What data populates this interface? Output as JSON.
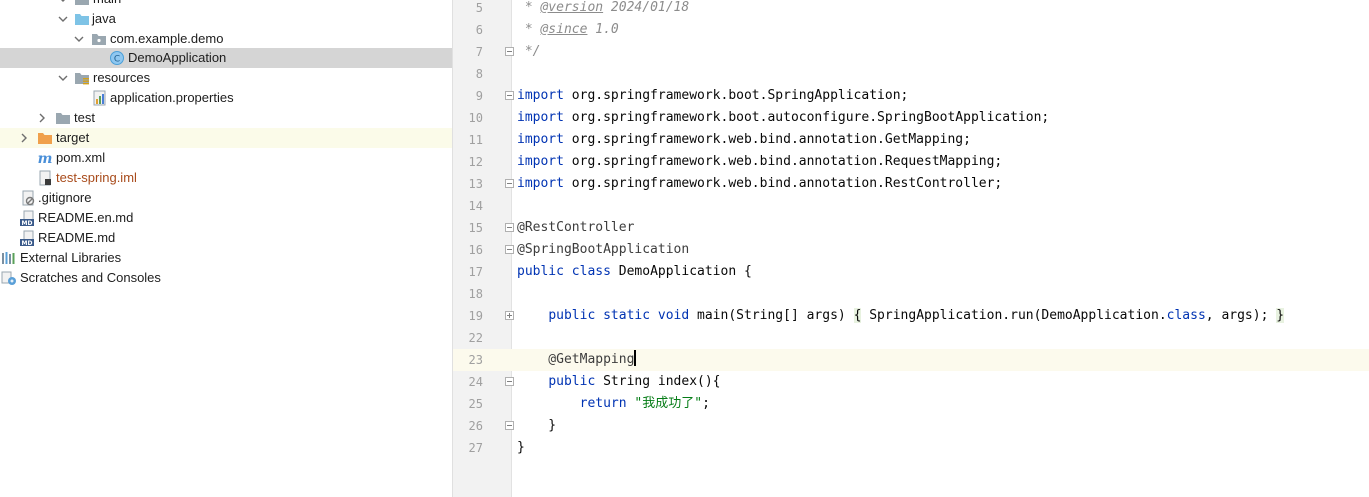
{
  "project_tree": {
    "items": [
      {
        "label": "main",
        "icon": "folder-icon"
      },
      {
        "label": "java",
        "icon": "source-folder-icon"
      },
      {
        "label": "com.example.demo",
        "icon": "package-icon"
      },
      {
        "label": "DemoApplication",
        "icon": "java-class-icon"
      },
      {
        "label": "resources",
        "icon": "resources-folder-icon"
      },
      {
        "label": "application.properties",
        "icon": "properties-file-icon"
      },
      {
        "label": "test",
        "icon": "folder-icon"
      },
      {
        "label": "target",
        "icon": "excluded-folder-icon"
      },
      {
        "label": "pom.xml",
        "icon": "maven-icon"
      },
      {
        "label": "test-spring.iml",
        "icon": "iml-file-icon"
      },
      {
        "label": ".gitignore",
        "icon": "gitignore-icon"
      },
      {
        "label": "README.en.md",
        "icon": "markdown-icon"
      },
      {
        "label": "README.md",
        "icon": "markdown-icon"
      },
      {
        "label": "External Libraries",
        "icon": "libraries-icon"
      },
      {
        "label": "Scratches and Consoles",
        "icon": "scratches-icon"
      }
    ]
  },
  "editor": {
    "line_numbers": [
      "5",
      "6",
      "7",
      "8",
      "9",
      "10",
      "11",
      "12",
      "13",
      "14",
      "15",
      "16",
      "17",
      "18",
      "19",
      "22",
      "23",
      "24",
      "25",
      "26",
      "27"
    ],
    "javadoc": {
      "star": " * ",
      "version_tag": "@version",
      "version_value": " 2024/01/18",
      "since_tag": "@since",
      "since_value": " 1.0",
      "end": " */"
    },
    "import_kw": "import",
    "imports": [
      " org.springframework.boot.SpringApplication;",
      " org.springframework.boot.autoconfigure.SpringBootApplication;",
      " org.springframework.web.bind.annotation.GetMapping;",
      " org.springframework.web.bind.annotation.RequestMapping;",
      " org.springframework.web.bind.annotation.RestController;"
    ],
    "ann_rest": "@RestController",
    "ann_boot": "@SpringBootApplication",
    "class_decl": {
      "kw1": "public",
      "kw2": " class",
      "name": " DemoApplication {"
    },
    "main_method": {
      "indent": "    ",
      "kw": "public static void",
      "sig": " main(String[] args) ",
      "open": "{",
      "body": " SpringApplication.run(DemoApplication.",
      "cls_kw": "class",
      "tail": ", args); ",
      "close": "}"
    },
    "get_mapping": "    @GetMapping",
    "index_method": {
      "indent": "    ",
      "kw": "public",
      "rest": " String index(){"
    },
    "return_line": {
      "indent": "        ",
      "kw": "return",
      "space": " ",
      "str": "\"我成功了\"",
      "semi": ";"
    },
    "close_method": "    }",
    "close_class": "}"
  }
}
